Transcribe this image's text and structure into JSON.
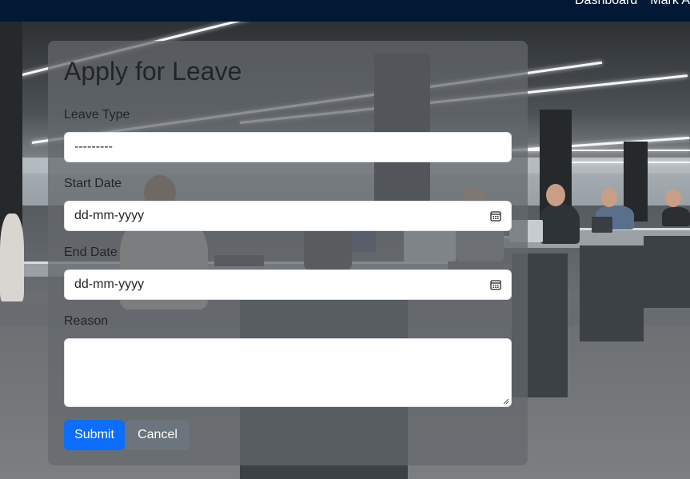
{
  "navbar": {
    "links": [
      "Dashboard",
      "Mark A"
    ]
  },
  "form": {
    "title": "Apply for Leave",
    "leave_type": {
      "label": "Leave Type",
      "value": "---------"
    },
    "start_date": {
      "label": "Start Date",
      "placeholder": "dd-mm-yyyy"
    },
    "end_date": {
      "label": "End Date",
      "placeholder": "dd-mm-yyyy"
    },
    "reason": {
      "label": "Reason",
      "value": ""
    },
    "submit_label": "Submit",
    "cancel_label": "Cancel"
  },
  "icons": {
    "date_picker": "calendar-icon"
  },
  "colors": {
    "navbar_bg": "#021936",
    "primary": "#0d6efd",
    "secondary": "#6c757d"
  }
}
